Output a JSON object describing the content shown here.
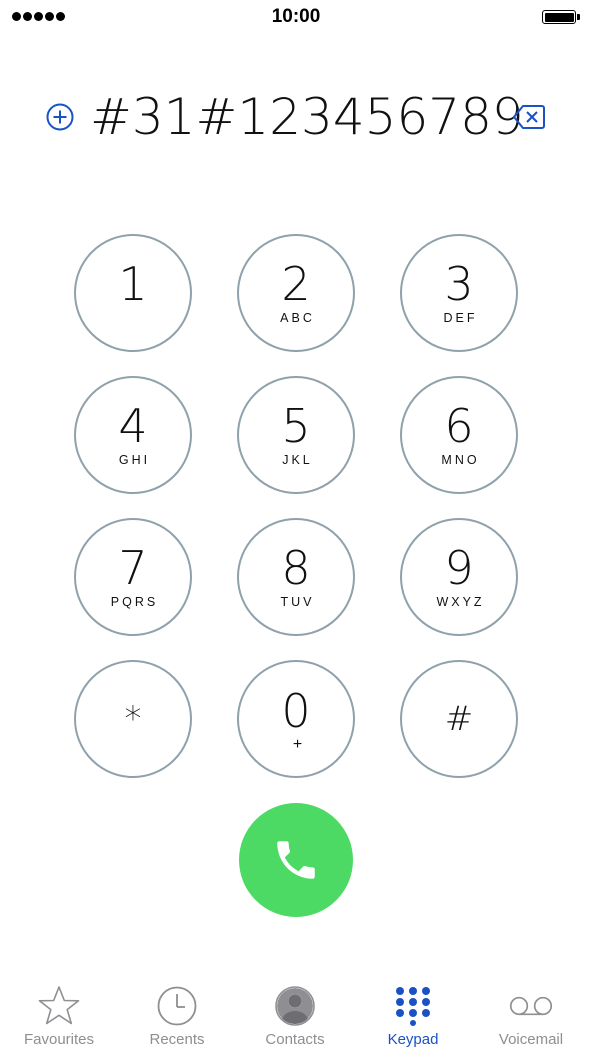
{
  "status_bar": {
    "time": "10:00",
    "signal_dots": 5
  },
  "dialer": {
    "number": "#31#123456789"
  },
  "keypad": {
    "keys": [
      {
        "digit": "1",
        "letters": ""
      },
      {
        "digit": "2",
        "letters": "ABC"
      },
      {
        "digit": "3",
        "letters": "DEF"
      },
      {
        "digit": "4",
        "letters": "GHI"
      },
      {
        "digit": "5",
        "letters": "JKL"
      },
      {
        "digit": "6",
        "letters": "MNO"
      },
      {
        "digit": "7",
        "letters": "PQRS"
      },
      {
        "digit": "8",
        "letters": "TUV"
      },
      {
        "digit": "9",
        "letters": "WXYZ"
      },
      {
        "digit": "*",
        "letters": ""
      },
      {
        "digit": "0",
        "letters": "+"
      },
      {
        "digit": "#",
        "letters": ""
      }
    ]
  },
  "tab_bar": {
    "tabs": [
      {
        "label": "Favourites",
        "icon": "star-icon",
        "active": false
      },
      {
        "label": "Recents",
        "icon": "clock-icon",
        "active": false
      },
      {
        "label": "Contacts",
        "icon": "person-icon",
        "active": false
      },
      {
        "label": "Keypad",
        "icon": "keypad-grid-icon",
        "active": true
      },
      {
        "label": "Voicemail",
        "icon": "voicemail-icon",
        "active": false
      }
    ]
  },
  "colors": {
    "accent": "#1a52c4",
    "call_green": "#4cd964",
    "key_border": "#8fa1aa",
    "inactive_tab": "#8e8e93"
  }
}
